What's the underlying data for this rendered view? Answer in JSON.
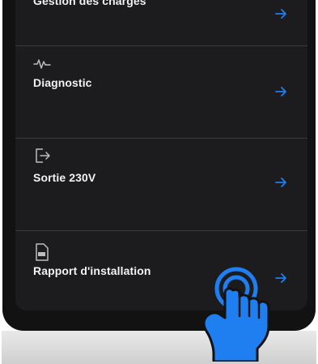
{
  "menu": {
    "items": [
      {
        "label": "Gestion des charges",
        "icon": "none"
      },
      {
        "label": "Diagnostic",
        "icon": "pulse-icon"
      },
      {
        "label": "Sortie 230V",
        "icon": "exit-icon"
      },
      {
        "label": "Rapport d'installation",
        "icon": "pdf-document-icon"
      }
    ]
  },
  "colors": {
    "background": "#1c1c1e",
    "text": "#f2f2f2",
    "arrow": "#1f7ff0",
    "hand": "#1f7ff0"
  }
}
